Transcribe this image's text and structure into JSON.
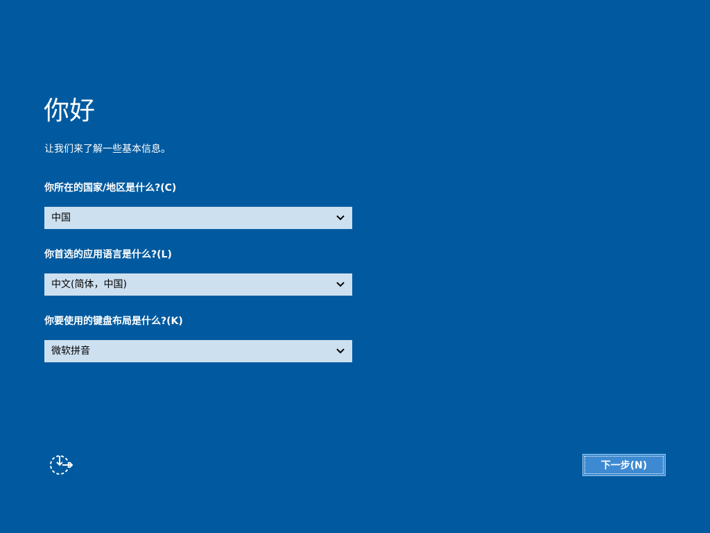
{
  "page": {
    "title": "你好",
    "subtitle": "让我们来了解一些基本信息。"
  },
  "questions": [
    {
      "label": "你所在的国家/地区是什么?(C)",
      "selected": "中国"
    },
    {
      "label": "你首选的应用语言是什么?(L)",
      "selected": "中文(简体，中国)"
    },
    {
      "label": "你要使用的键盘布局是什么?(K)",
      "selected": "微软拼音"
    }
  ],
  "footer": {
    "accessibility_icon": "ease-of-access-icon",
    "next_label": "下一步(N)"
  },
  "colors": {
    "background": "#015a9f",
    "select_background": "#cde0f0",
    "button_background": "#3d8ad2"
  }
}
